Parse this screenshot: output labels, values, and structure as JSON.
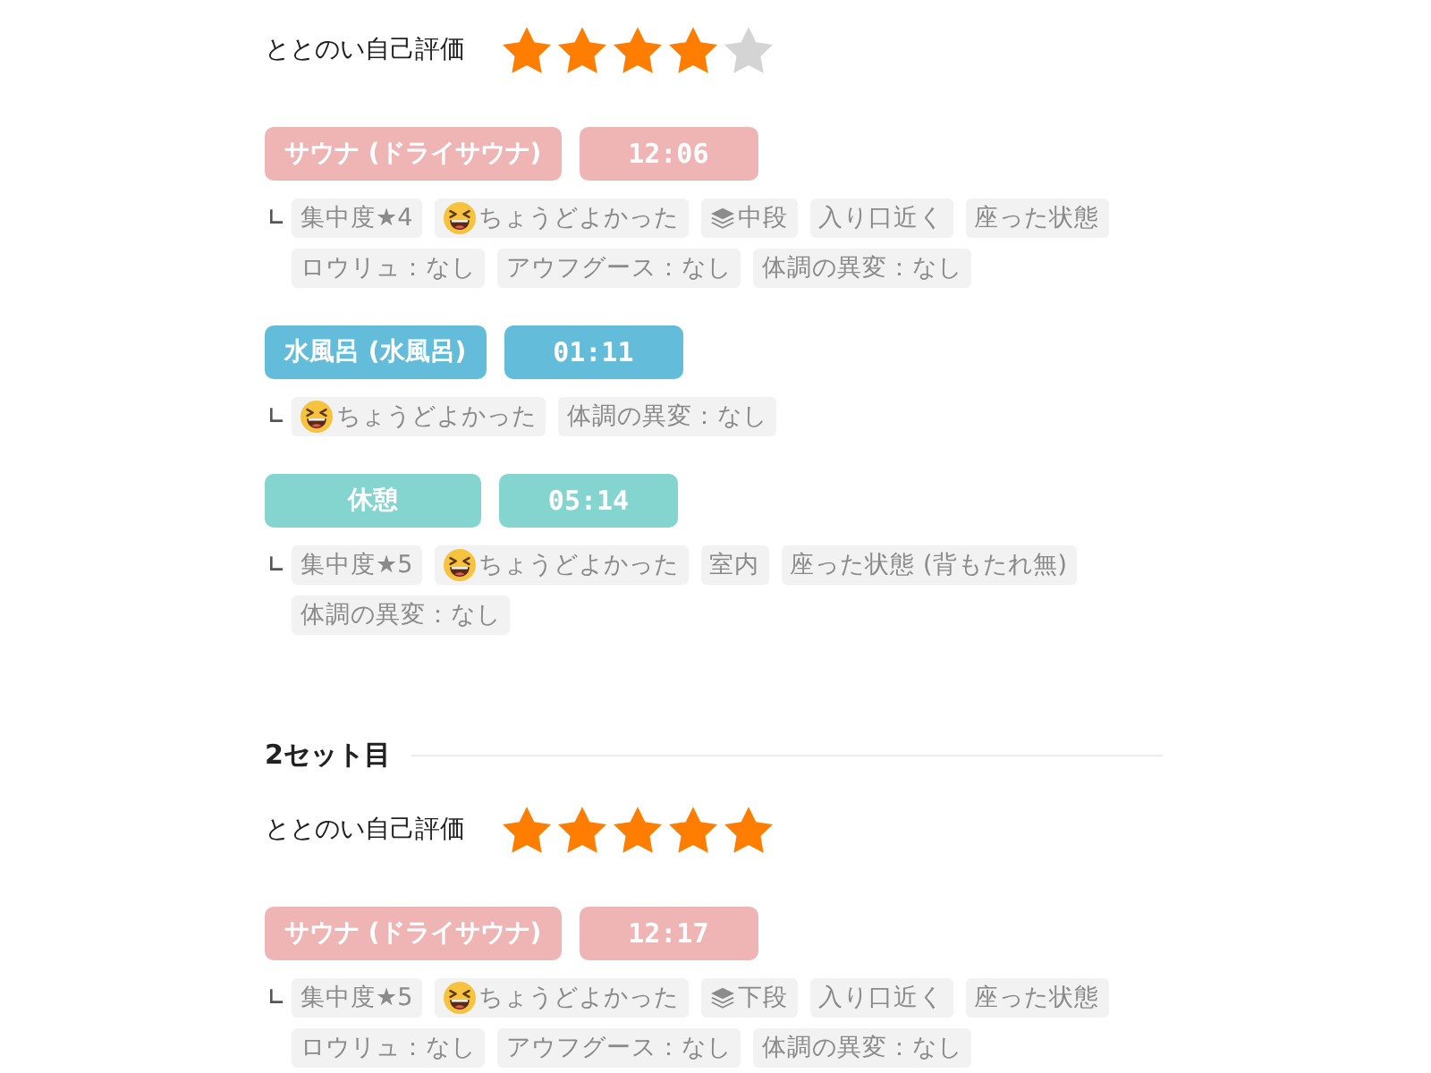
{
  "sets": [
    {
      "rating": {
        "label": "ととのい自己評価",
        "stars": 4
      },
      "steps": [
        {
          "name": "サウナ (ドライサウナ)",
          "time": "12:06",
          "color": "#efb4b4",
          "tags": [
            {
              "kind": "plain",
              "text": "集中度★4"
            },
            {
              "kind": "face",
              "text": "ちょうどよかった"
            },
            {
              "kind": "layers",
              "text": "中段"
            },
            {
              "kind": "plain",
              "text": "入り口近く"
            },
            {
              "kind": "plain",
              "text": "座った状態"
            },
            {
              "kind": "plain",
              "text": "ロウリュ：なし"
            },
            {
              "kind": "plain",
              "text": "アウフグース：なし"
            },
            {
              "kind": "plain",
              "text": "体調の異変：なし"
            }
          ]
        },
        {
          "name": "水風呂 (水風呂)",
          "time": "01:11",
          "color": "#63bcda",
          "tags": [
            {
              "kind": "face",
              "text": "ちょうどよかった"
            },
            {
              "kind": "plain",
              "text": "体調の異変：なし"
            }
          ]
        },
        {
          "name": "休憩",
          "time": "05:14",
          "color": "#84d5cf",
          "tags": [
            {
              "kind": "plain",
              "text": "集中度★5"
            },
            {
              "kind": "face",
              "text": "ちょうどよかった"
            },
            {
              "kind": "plain",
              "text": "室内"
            },
            {
              "kind": "plain",
              "text": "座った状態 (背もたれ無)"
            },
            {
              "kind": "plain",
              "text": "体調の異変：なし"
            }
          ]
        }
      ]
    },
    {
      "title": "2セット目",
      "rating": {
        "label": "ととのい自己評価",
        "stars": 5
      },
      "steps": [
        {
          "name": "サウナ (ドライサウナ)",
          "time": "12:17",
          "color": "#efb4b4",
          "tags": [
            {
              "kind": "plain",
              "text": "集中度★5"
            },
            {
              "kind": "face",
              "text": "ちょうどよかった"
            },
            {
              "kind": "layers",
              "text": "下段"
            },
            {
              "kind": "plain",
              "text": "入り口近く"
            },
            {
              "kind": "plain",
              "text": "座った状態"
            },
            {
              "kind": "plain",
              "text": "ロウリュ：なし"
            },
            {
              "kind": "plain",
              "text": "アウフグース：なし"
            },
            {
              "kind": "plain",
              "text": "体調の異変：なし"
            }
          ]
        }
      ]
    }
  ]
}
